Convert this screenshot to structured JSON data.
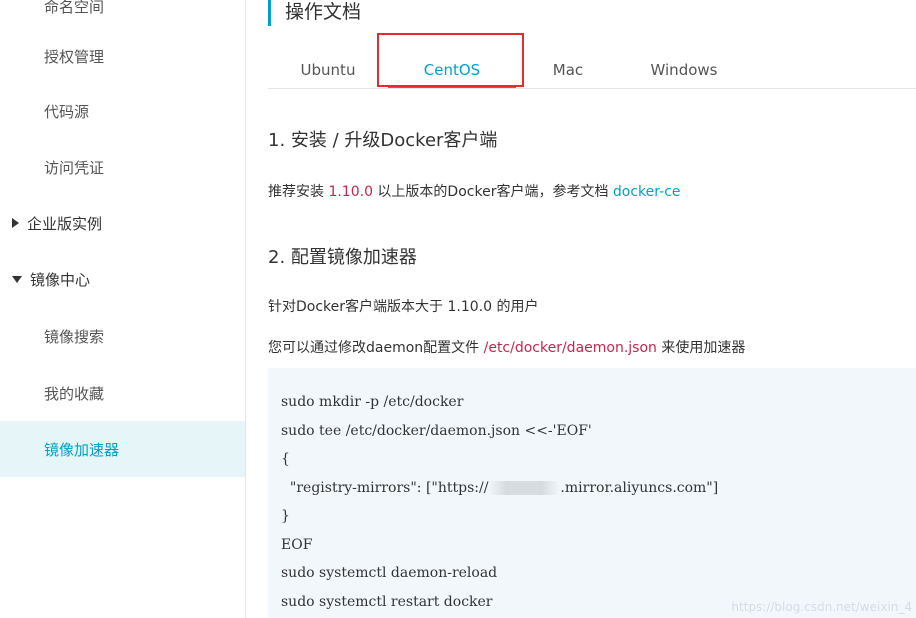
{
  "sidebar": {
    "items": [
      {
        "label": "命名空间",
        "type": "sub"
      },
      {
        "label": "授权管理",
        "type": "sub"
      },
      {
        "label": "代码源",
        "type": "sub"
      },
      {
        "label": "访问凭证",
        "type": "sub"
      },
      {
        "label": "企业版实例",
        "type": "group",
        "icon": "caret-right-icon"
      },
      {
        "label": "镜像中心",
        "type": "group",
        "icon": "caret-down-icon"
      },
      {
        "label": "镜像搜索",
        "type": "sub"
      },
      {
        "label": "我的收藏",
        "type": "sub"
      },
      {
        "label": "镜像加速器",
        "type": "sub",
        "active": true
      }
    ]
  },
  "main": {
    "title": "操作文档",
    "tabs": [
      {
        "label": "Ubuntu"
      },
      {
        "label": "CentOS",
        "active": true
      },
      {
        "label": "Mac"
      },
      {
        "label": "Windows"
      }
    ],
    "section1": {
      "title": "1. 安装 / 升级Docker客户端",
      "text_prefix": "推荐安装 ",
      "version": "1.10.0",
      "text_mid": " 以上版本的Docker客户端，参考文档 ",
      "link": "docker-ce"
    },
    "section2": {
      "title": "2. 配置镜像加速器",
      "line1": "针对Docker客户端版本大于 1.10.0 的用户",
      "line2_prefix": "您可以通过修改daemon配置文件 ",
      "path": "/etc/docker/daemon.json",
      "line2_suffix": " 来使用加速器"
    },
    "code": {
      "l1": "sudo mkdir -p /etc/docker",
      "l2": "sudo tee /etc/docker/daemon.json <<-'EOF'",
      "l3": "{",
      "l4a": "  \"registry-mirrors\": [\"https://",
      "l4b": ".mirror.aliyuncs.com\"]",
      "l5": "}",
      "l6": "EOF",
      "l7": "sudo systemctl daemon-reload",
      "l8": "sudo systemctl restart docker"
    }
  },
  "colors": {
    "accent": "#00a2ca",
    "highlight": "#c7254e",
    "annotation": "#e52b2b",
    "code_bg": "#f2f7fb",
    "active_bg": "#e6f5f7"
  },
  "watermark": "https://blog.csdn.net/weixin_4"
}
